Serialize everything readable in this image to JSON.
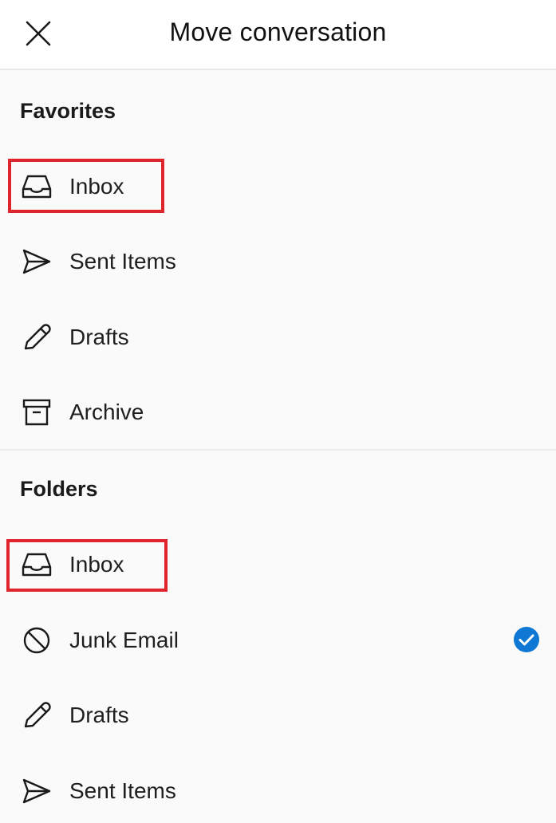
{
  "header": {
    "title": "Move conversation",
    "close_icon": "close-icon"
  },
  "favorites": {
    "title": "Favorites",
    "items": [
      {
        "label": "Inbox",
        "icon": "inbox-icon",
        "highlighted": true
      },
      {
        "label": "Sent Items",
        "icon": "send-icon"
      },
      {
        "label": "Drafts",
        "icon": "pencil-icon"
      },
      {
        "label": "Archive",
        "icon": "archive-icon"
      }
    ]
  },
  "folders": {
    "title": "Folders",
    "items": [
      {
        "label": "Inbox",
        "icon": "inbox-icon",
        "highlighted": true
      },
      {
        "label": "Junk Email",
        "icon": "block-icon",
        "selected": true
      },
      {
        "label": "Drafts",
        "icon": "pencil-icon"
      },
      {
        "label": "Sent Items",
        "icon": "send-icon"
      }
    ]
  },
  "colors": {
    "highlight": "#e0242b",
    "check": "#0f78d4"
  }
}
